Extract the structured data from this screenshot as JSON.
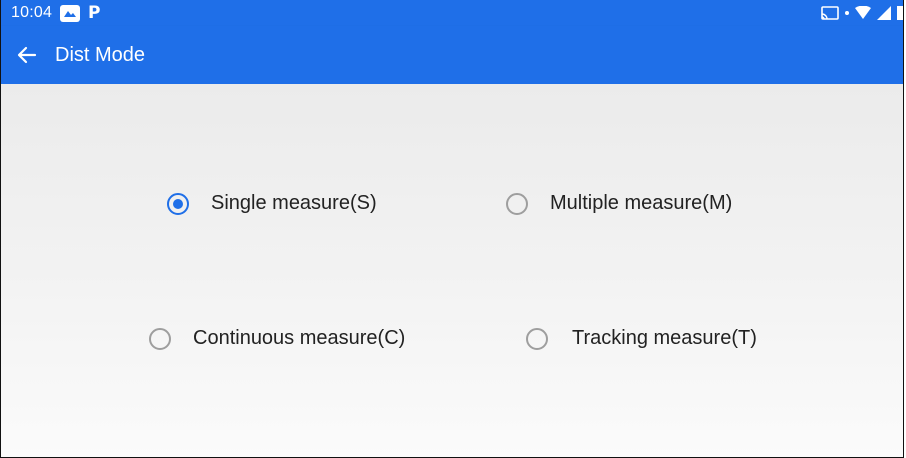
{
  "status_bar": {
    "time": "10:04",
    "notification_icons": [
      "photos-icon",
      "parking-icon"
    ],
    "notif_letter": "P",
    "system_icons": [
      "cast-icon",
      "wifi-icon",
      "signal-icon",
      "battery-icon"
    ]
  },
  "app_bar": {
    "title": "Dist Mode",
    "back_icon": "arrow-left-icon"
  },
  "options": [
    {
      "label": "Single measure(S)",
      "checked": true
    },
    {
      "label": "Multiple measure(M)",
      "checked": false
    },
    {
      "label": "Continuous measure(C)",
      "checked": false
    },
    {
      "label": "Tracking measure(T)",
      "checked": false
    }
  ],
  "colors": {
    "primary": "#1f6fe8",
    "radio_unchecked": "#9e9e9e",
    "text": "#222222"
  }
}
